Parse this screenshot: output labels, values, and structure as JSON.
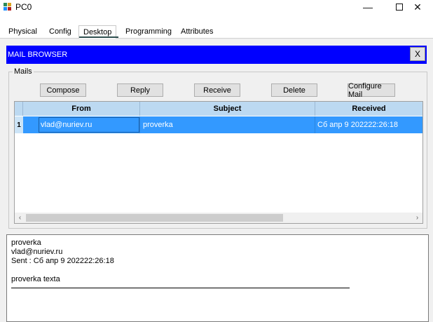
{
  "window": {
    "title": "PC0"
  },
  "tabs": [
    {
      "label": "Physical"
    },
    {
      "label": "Config"
    },
    {
      "label": "Desktop"
    },
    {
      "label": "Programming"
    },
    {
      "label": "Attributes"
    }
  ],
  "active_tab": "Desktop",
  "mail_browser": {
    "title": "MAIL BROWSER",
    "close_label": "X",
    "group_label": "Mails",
    "buttons": {
      "compose": "Compose",
      "reply": "Reply",
      "receive": "Receive",
      "delete": "Delete",
      "configure": "Configure Mail"
    },
    "table": {
      "headers": {
        "from": "From",
        "subject": "Subject",
        "received": "Received"
      },
      "rows": [
        {
          "num": "1",
          "from": "vlad@nuriev.ru",
          "subject": "proverka",
          "received": "Сб апр 9 202222:26:18"
        }
      ]
    },
    "scroll": {
      "left_arrow": "‹",
      "right_arrow": "›"
    },
    "message": {
      "subject": "proverka",
      "from": "vlad@nuriev.ru",
      "sent": "Sent : Сб апр 9 202222:26:18",
      "body": "proverka texta"
    }
  }
}
